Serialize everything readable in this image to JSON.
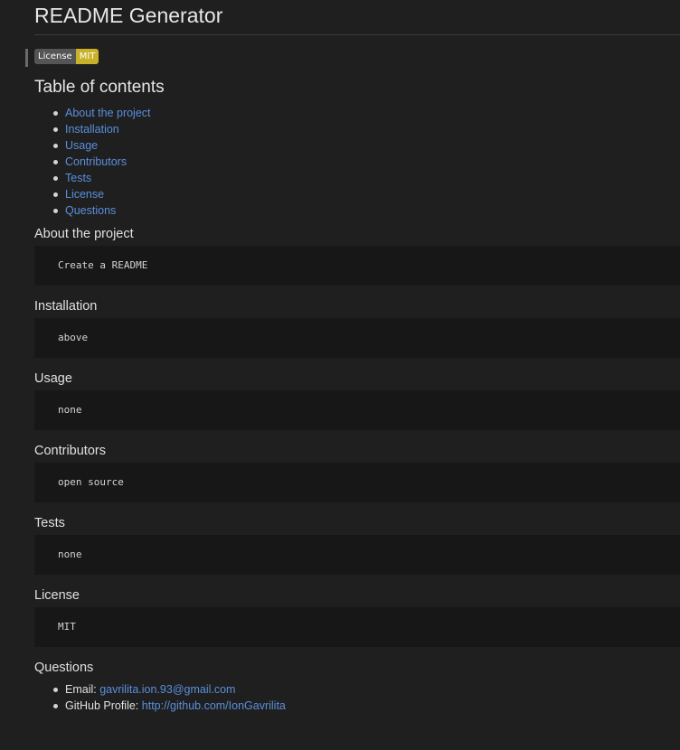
{
  "title": "README Generator",
  "badge": {
    "label": "License",
    "value": "MIT"
  },
  "toc": {
    "heading": "Table of contents",
    "items": [
      {
        "label": "About the project"
      },
      {
        "label": "Installation"
      },
      {
        "label": "Usage"
      },
      {
        "label": "Contributors"
      },
      {
        "label": "Tests"
      },
      {
        "label": "License"
      },
      {
        "label": "Questions"
      }
    ]
  },
  "sections": {
    "about": {
      "title": "About the project",
      "code": "Create a README"
    },
    "installation": {
      "title": "Installation",
      "code": "above"
    },
    "usage": {
      "title": "Usage",
      "code": "none"
    },
    "contributors": {
      "title": "Contributors",
      "code": "open source"
    },
    "tests": {
      "title": "Tests",
      "code": "none"
    },
    "license": {
      "title": "License",
      "code": "MIT"
    }
  },
  "questions": {
    "title": "Questions",
    "email_label": "Email:",
    "email": "gavrilita.ion.93@gmail.com",
    "github_label": "GitHub Profile:",
    "github": "http://github.com/IonGavrilita"
  },
  "colors": {
    "background": "#1f1f1f",
    "link": "#5a8fdc",
    "code_background": "#171717",
    "badge_label": "#555555",
    "badge_value": "#c9b22a"
  }
}
